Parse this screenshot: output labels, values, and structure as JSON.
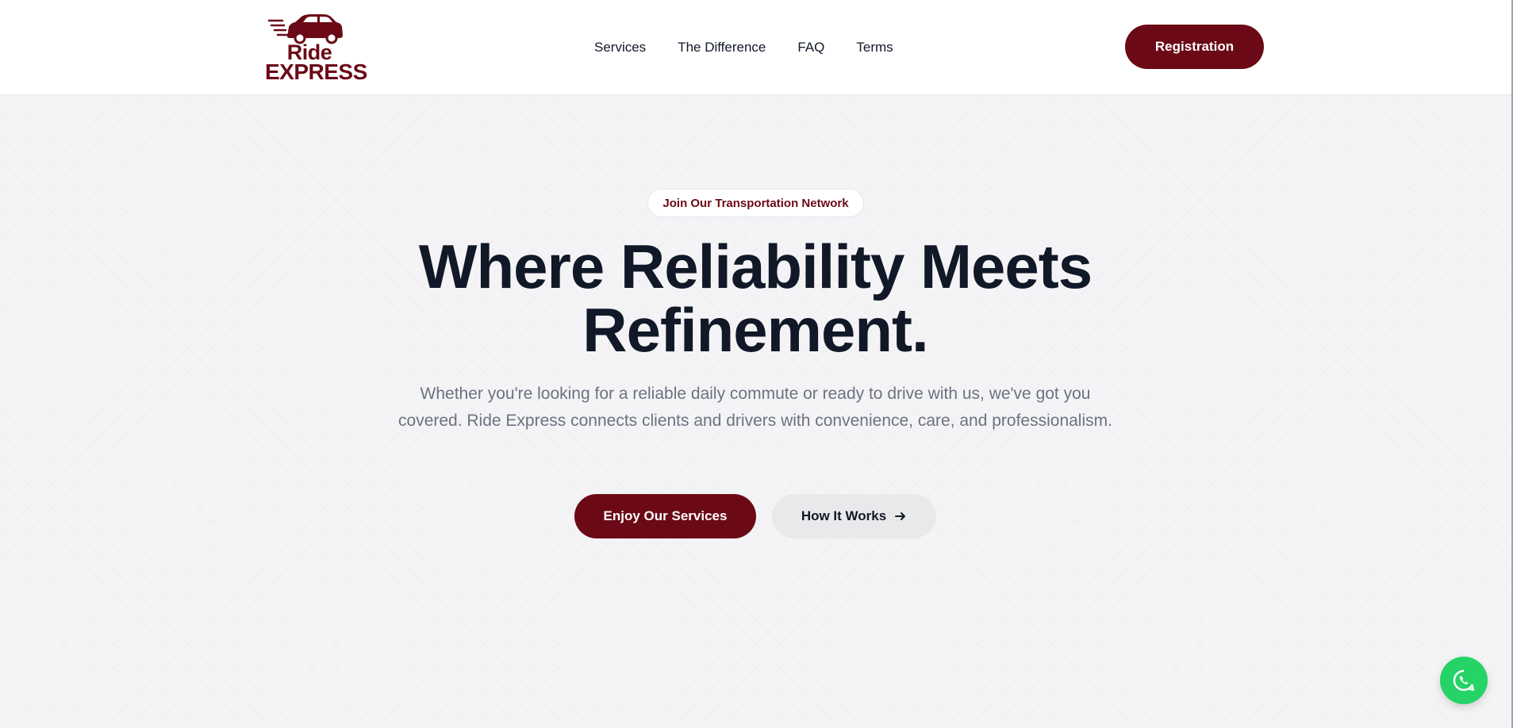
{
  "brand": {
    "logo_line_1": "Ride",
    "logo_line_2": "EXPRESS",
    "color": "#6b0a16"
  },
  "nav": {
    "items": [
      {
        "label": "Services"
      },
      {
        "label": "The Difference"
      },
      {
        "label": "FAQ"
      },
      {
        "label": "Terms"
      }
    ],
    "cta_label": "Registration"
  },
  "hero": {
    "badge": "Join Our Transportation Network",
    "title_line_1": "Where Reliability Meets",
    "title_line_2": "Refinement.",
    "subtitle": "Whether you're looking for a reliable daily commute or ready to drive with us, we've got you covered. Ride Express connects clients and drivers with convenience, care, and professionalism.",
    "primary_button": "Enjoy Our Services",
    "secondary_button": "How It Works",
    "secondary_icon": "arrow-right-icon"
  },
  "floating": {
    "icon": "whatsapp-icon",
    "color": "#25d366"
  }
}
